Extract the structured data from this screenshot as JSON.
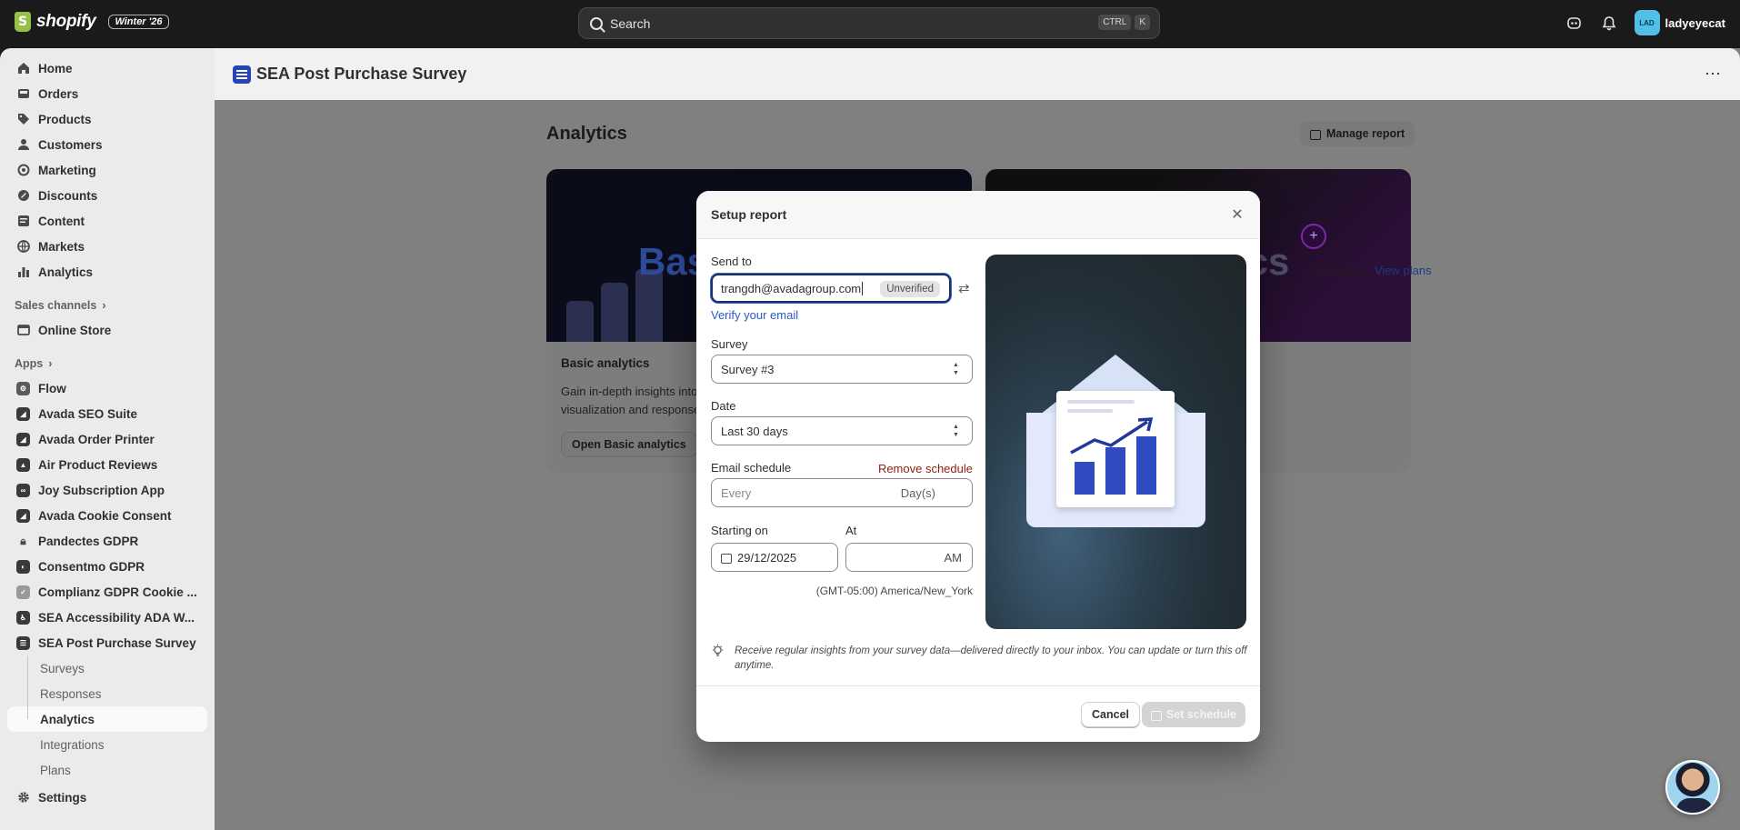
{
  "topbar": {
    "brand": "shopify",
    "edition_badge": "Winter '26",
    "search_placeholder": "Search",
    "shortcut_keys": [
      "CTRL",
      "K"
    ],
    "user_initials": "LAD",
    "user_name": "ladyeyecat"
  },
  "sidebar": {
    "main_items": [
      {
        "label": "Home",
        "icon": "home-icon"
      },
      {
        "label": "Orders",
        "icon": "inbox-icon"
      },
      {
        "label": "Products",
        "icon": "tag-icon"
      },
      {
        "label": "Customers",
        "icon": "person-icon"
      },
      {
        "label": "Marketing",
        "icon": "target-icon"
      },
      {
        "label": "Discounts",
        "icon": "discount-icon"
      },
      {
        "label": "Content",
        "icon": "content-icon"
      },
      {
        "label": "Markets",
        "icon": "globe-icon"
      },
      {
        "label": "Analytics",
        "icon": "bar-chart-icon"
      }
    ],
    "sales_channels_label": "Sales channels",
    "online_store_label": "Online Store",
    "apps_label": "Apps",
    "apps": [
      {
        "label": "Flow"
      },
      {
        "label": "Avada SEO Suite"
      },
      {
        "label": "Avada Order Printer"
      },
      {
        "label": "Air Product Reviews"
      },
      {
        "label": "Joy Subscription App"
      },
      {
        "label": "Avada Cookie Consent"
      },
      {
        "label": "Pandectes GDPR"
      },
      {
        "label": "Consentmo GDPR"
      },
      {
        "label": "Complianz GDPR Cookie ..."
      },
      {
        "label": "SEA Accessibility ADA W..."
      },
      {
        "label": "SEA Post Purchase Survey"
      }
    ],
    "sub_items": [
      "Surveys",
      "Responses",
      "Analytics",
      "Integrations",
      "Plans"
    ],
    "active_sub_item": "Analytics",
    "settings_label": "Settings"
  },
  "app_header": {
    "title": "SEA Post Purchase Survey"
  },
  "page": {
    "title": "Analytics",
    "manage_report_label": "Manage report",
    "basic_card": {
      "hero_text": "Bas",
      "heading": "Basic analytics",
      "description_line1": "Gain in-depth insights into",
      "description_line2": "visualization and response",
      "button_label": "Open Basic analytics"
    },
    "advanced_card": {
      "hero_text": "ics",
      "description": "gher plans.",
      "link_label": "View plans"
    }
  },
  "modal": {
    "title": "Setup report",
    "send_to_label": "Send to",
    "email_value": "trangdh@avadagroup.com",
    "email_status": "Unverified",
    "verify_link": "Verify your email",
    "survey_label": "Survey",
    "survey_value": "Survey #3",
    "date_label": "Date",
    "date_value": "Last 30 days",
    "email_schedule_label": "Email schedule",
    "remove_schedule_label": "Remove schedule",
    "every_placeholder": "Every",
    "days_suffix": "Day(s)",
    "starting_on_label": "Starting on",
    "starting_on_value": "29/12/2025",
    "at_label": "At",
    "at_suffix": "AM",
    "timezone": "(GMT-05:00) America/New_York",
    "tip_text": "Receive regular insights from your survey data—delivered directly to your inbox. You can update or turn this off anytime.",
    "cancel_label": "Cancel",
    "set_schedule_label": "Set schedule"
  }
}
